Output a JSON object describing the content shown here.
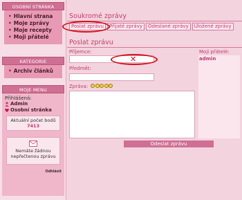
{
  "sidebar": {
    "personal": {
      "title": "OSOBNÍ STRÁNKA",
      "items": [
        {
          "label": "Hlavní strana"
        },
        {
          "label": "Moje zprávy"
        },
        {
          "label": "Moje recepty"
        },
        {
          "label": "Moji přátelé"
        }
      ]
    },
    "category": {
      "title": "KATEGORIE",
      "items": [
        {
          "label": "Archiv článků"
        }
      ]
    },
    "mymenu": {
      "title": "MOJE MENU",
      "login_label": "Přihlášená:",
      "user_admin": "Admin",
      "user_page": "Osobní stránka",
      "points_label": "Aktuální počet bodů",
      "points_value": "7413",
      "messages_line1": "Nemáte žádnou",
      "messages_line2": "nepřečtenou zprávu",
      "logout": "Odhlásit"
    }
  },
  "main": {
    "title": "Soukromé zprávy",
    "tabs": [
      {
        "label": "Poslat zprávu"
      },
      {
        "label": "Přijaté zprávy"
      },
      {
        "label": "Odeslané zprávy"
      },
      {
        "label": "Uložené zprávy"
      }
    ],
    "form": {
      "title": "Poslat zprávu",
      "recipient_label": "Příjemce:",
      "recipient_value": "",
      "subject_label": "Předmět:",
      "subject_value": "",
      "message_label": "Zpráva:",
      "message_value": "",
      "send_label": "Odeslat zprávu"
    },
    "friends": {
      "label": "Moji přátelé:",
      "items": [
        {
          "name": "admin"
        }
      ]
    }
  },
  "colors": {
    "accent": "#c23a6b",
    "header": "#cf6f92",
    "annotation": "#d4121e",
    "background": "#f3d3de"
  },
  "icons": [
    "user-icon",
    "heart-icon",
    "envelope-icon",
    "smiley-icon",
    "close-x-icon"
  ]
}
